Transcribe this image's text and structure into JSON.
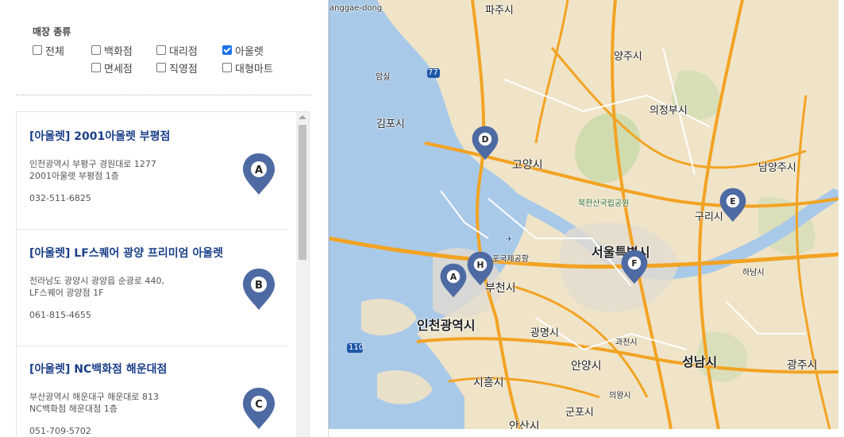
{
  "filter": {
    "title": "매장 종류",
    "options": [
      {
        "label": "전체",
        "checked": false
      },
      {
        "label": "백화점",
        "checked": false
      },
      {
        "label": "대리점",
        "checked": false
      },
      {
        "label": "아울렛",
        "checked": true
      },
      {
        "label": "면세점",
        "checked": false
      },
      {
        "label": "직영점",
        "checked": false
      },
      {
        "label": "대형마트",
        "checked": false
      }
    ]
  },
  "stores": [
    {
      "marker": "A",
      "name": "[아울렛] 2001아울렛 부평점",
      "address_line1": "인천광역시 부평구 경원대로 1277",
      "address_line2": "2001아울렛 부평점 1층",
      "phone": "032-511-6825"
    },
    {
      "marker": "B",
      "name": "[아울렛] LF스퀘어 광양 프리미엄 아울렛",
      "address_line1": "전라남도 광양시 광양읍 순광로 440,",
      "address_line2": "LF스퀘어 광양점 1F",
      "phone": "061-815-4655"
    },
    {
      "marker": "C",
      "name": "[아울렛] NC백화점 해운대점",
      "address_line1": "부산광역시 해운대구 해운대로 813",
      "address_line2": "NC백화점 해운대점 1층",
      "phone": "051-709-5702"
    }
  ],
  "map": {
    "labels": {
      "top_left": "anggae-dong",
      "top": "파주시",
      "yangju": "양주시",
      "amsil": "암실",
      "road77": "77",
      "uijeongbu": "의정부시",
      "gimpo": "김포시",
      "goyang": "고양시",
      "namyangju": "남양주시",
      "bukhansan": "북한산국립공원",
      "guri": "구리시",
      "airport": "포국제공항",
      "seoul": "서울특별시",
      "hanam": "하남시",
      "bucheon": "부천시",
      "incheon": "인천광역시",
      "gwangmyeong": "광명시",
      "road110": "110",
      "gwacheon": "과천시",
      "anyang": "안양시",
      "seongnam": "성남시",
      "gwangju": "광주시",
      "siheung": "시흥시",
      "uiwang": "의왕시",
      "gunpo": "군포시",
      "ansan": "안산시"
    },
    "markers": [
      "D",
      "E",
      "H",
      "A",
      "F"
    ]
  },
  "colors": {
    "pin": "#4e6aa3",
    "water": "#a9c9e8",
    "road_major": "#f2a323",
    "road_minor": "#ffffff",
    "checkbox_checked": "#1a73e8",
    "store_name": "#1a3f88"
  }
}
